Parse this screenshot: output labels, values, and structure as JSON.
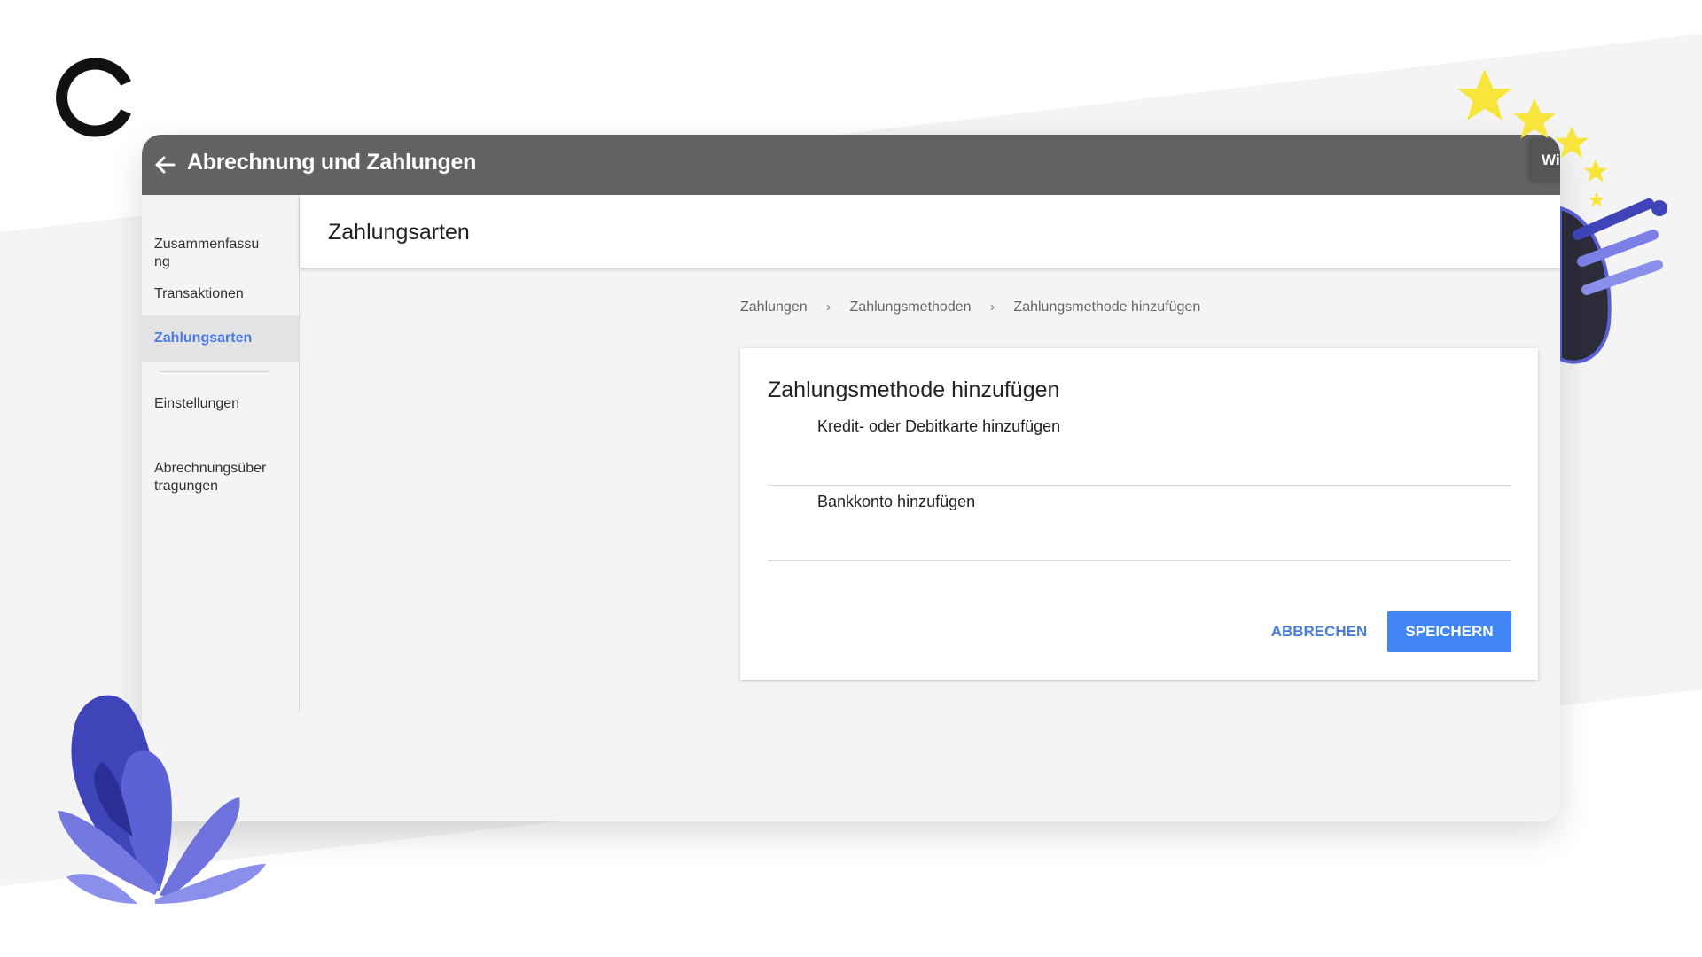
{
  "app": {
    "title": "Abrechnung und Zahlungen",
    "tab_fragment": "Wi"
  },
  "icons": {
    "back": "arrow-left-icon",
    "breadcrumb_separator": "chevron-right-icon",
    "brand": "c-logo",
    "stars": "stars-decoration",
    "plant": "plant-decoration"
  },
  "colors": {
    "appbar": "#626262",
    "accent": "#4a7ce0",
    "primary_button": "#4285f4",
    "decoration_purple": "#5c62d6",
    "star_yellow": "#f7e53b"
  },
  "sidebar": {
    "items": [
      {
        "label": "Zusammenfassu\nng"
      },
      {
        "label": "Transaktionen"
      },
      {
        "label": "Zahlungsarten",
        "active": true
      },
      {
        "label": "Einstellungen"
      },
      {
        "label": "Abrechnungsüber\ntragungen"
      }
    ]
  },
  "section": {
    "title": "Zahlungsarten"
  },
  "breadcrumb": {
    "items": [
      "Zahlungen",
      "Zahlungsmethoden",
      "Zahlungsmethode hinzufügen"
    ],
    "separator": "›"
  },
  "dialog": {
    "title": "Zahlungsmethode hinzufügen",
    "options": [
      {
        "label": "Kredit- oder Debitkarte hinzufügen"
      },
      {
        "label": "Bankkonto hinzufügen"
      }
    ],
    "cancel_label": "ABBRECHEN",
    "save_label": "SPEICHERN"
  }
}
